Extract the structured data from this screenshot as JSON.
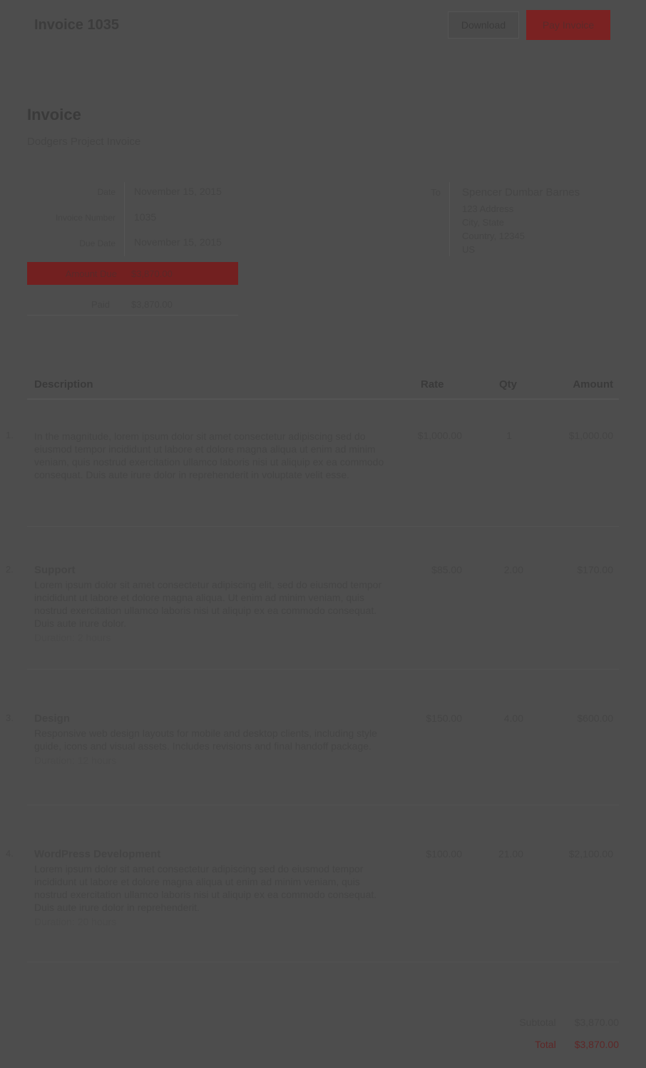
{
  "header": {
    "app_title": "Invoice 1035",
    "download_label": "Download",
    "pay_label": "Pay Invoice"
  },
  "document": {
    "title": "Invoice",
    "subtitle": "Dodgers Project Invoice"
  },
  "meta": {
    "date_label": "Date",
    "date_value": "November 15, 2015",
    "invoice_no_label": "Invoice Number",
    "invoice_no_value": "1035",
    "due_label": "Due Date",
    "due_value": "November 15, 2015",
    "balance_label": "Amount Due",
    "balance_value": "$3,870.00",
    "paid_label": "Paid",
    "paid_value": "$3,870.00"
  },
  "to": {
    "label": "To",
    "name": "Spencer Dumbar Barnes",
    "lines": [
      "123 Address",
      "City, State",
      "Country, 12345",
      "US"
    ]
  },
  "table": {
    "col_description": "Description",
    "col_rate": "Rate",
    "col_qty": "Qty",
    "col_amount": "Amount",
    "items": [
      {
        "index": "1.",
        "title": "",
        "description": "In the magnitude, lorem ipsum dolor sit amet consectetur adipiscing sed do eiusmod tempor incididunt ut labore et dolore magna aliqua ut enim ad minim veniam, quis nostrud exercitation ullamco laboris nisi ut aliquip ex ea commodo consequat. Duis aute irure dolor in reprehenderit in voluptate velit esse.",
        "meta": "",
        "rate": "$1,000.00",
        "qty": "1",
        "amount": "$1,000.00"
      },
      {
        "index": "2.",
        "title": "Support",
        "description": "Lorem ipsum dolor sit amet consectetur adipiscing elit, sed do eiusmod tempor incididunt ut labore et dolore magna aliqua. Ut enim ad minim veniam, quis nostrud exercitation ullamco laboris nisi ut aliquip ex ea commodo consequat. Duis aute irure dolor.",
        "meta": "Duration: 2 hours",
        "rate": "$85.00",
        "qty": "2.00",
        "amount": "$170.00"
      },
      {
        "index": "3.",
        "title": "Design",
        "description": "Responsive web design layouts for mobile and desktop clients, including style guide, icons and visual assets. Includes revisions and final handoff package.",
        "meta": "Duration: 12 hours",
        "rate": "$150.00",
        "qty": "4.00",
        "amount": "$600.00"
      },
      {
        "index": "4.",
        "title": "WordPress Development",
        "description": "Lorem ipsum dolor sit amet consectetur adipiscing sed do eiusmod tempor incididunt ut labore et dolore magna aliqua ut enim ad minim veniam, quis nostrud exercitation ullamco laboris nisi ut aliquip ex ea commodo consequat. Duis aute irure dolor in reprehenderit.",
        "meta": "Duration: 20 hours",
        "rate": "$100.00",
        "qty": "21.00",
        "amount": "$2,100.00"
      }
    ]
  },
  "totals": {
    "subtotal_label": "Subtotal",
    "subtotal_value": "$3,870.00",
    "total_label": "Total",
    "total_value": "$3,870.00"
  },
  "colors": {
    "background": "#4d4d4d",
    "accent": "#7a2222"
  }
}
